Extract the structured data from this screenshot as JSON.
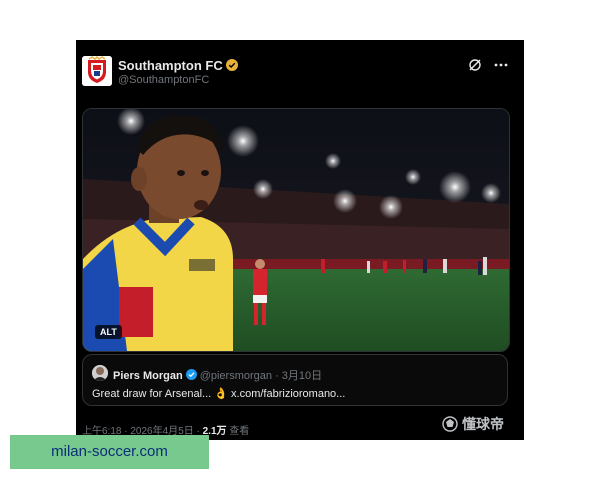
{
  "tweet": {
    "author_name": "Southampton FC",
    "author_handle": "@SouthamptonFC",
    "alt_label": "ALT",
    "quoted": {
      "name": "Piers Morgan",
      "handle": "@piersmorgan",
      "date": "· 3月10日",
      "text": "Great draw for Arsenal... 👌 x.com/fabrizioromano..."
    },
    "footer": {
      "time_date": "上午6:18 · 2026年4月5日 ·",
      "views_count": "2.1万",
      "views_label": "查看"
    }
  },
  "watermark": "懂球帝",
  "site_badge": "milan-soccer.com",
  "colors": {
    "background": "#000000",
    "verified_gold": "#e8b23a",
    "verified_blue": "#1d9bf0",
    "secondary_text": "#71767b",
    "badge_green": "#78c98e",
    "badge_text": "#0b2e7a"
  },
  "icons": [
    "southampton-crest-icon",
    "verified-badge-icon",
    "grok-icon",
    "more-options-icon",
    "watermark-logo-icon"
  ]
}
